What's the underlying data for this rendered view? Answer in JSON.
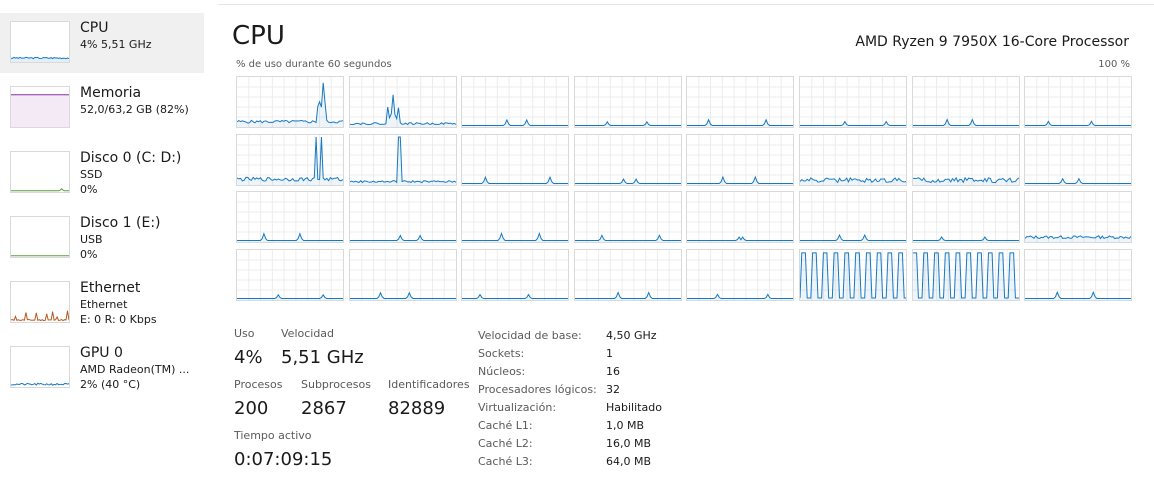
{
  "colors": {
    "cpu_line": "#1879c3",
    "memory_line": "#8b2fa8",
    "disk_line": "#5d9e3a",
    "ethernet_line": "#b8581e",
    "grid": "#ececec",
    "border": "#d9d9d9",
    "selected_bg": "#f0f0f0"
  },
  "sidebar": {
    "items": [
      {
        "title": "CPU",
        "lines": [
          "4% 5,51 GHz"
        ],
        "icon": "cpu-mini-graph"
      },
      {
        "title": "Memoria",
        "lines": [
          "52,0/63,2 GB (82%)"
        ],
        "icon": "memory-mini-graph"
      },
      {
        "title": "Disco 0 (C: D:)",
        "lines": [
          "SSD",
          "0%"
        ],
        "icon": "disk-mini-graph"
      },
      {
        "title": "Disco 1 (E:)",
        "lines": [
          "USB",
          "0%"
        ],
        "icon": "disk-mini-graph"
      },
      {
        "title": "Ethernet",
        "lines": [
          "Ethernet",
          "E: 0 R: 0 Kbps"
        ],
        "icon": "network-mini-graph"
      },
      {
        "title": "GPU 0",
        "lines": [
          "AMD Radeon(TM) ...",
          "2% (40 °C)"
        ],
        "icon": "gpu-mini-graph"
      }
    ]
  },
  "main": {
    "title": "CPU",
    "processor": "AMD Ryzen 9 7950X 16-Core Processor",
    "graph_caption": "% de uso durante 60 segundos",
    "graph_max": "100 %",
    "stats": {
      "uso_label": "Uso",
      "uso_value": "4%",
      "velocidad_label": "Velocidad",
      "velocidad_value": "5,51 GHz",
      "procesos_label": "Procesos",
      "procesos_value": "200",
      "subprocesos_label": "Subprocesos",
      "subprocesos_value": "2867",
      "identificadores_label": "Identificadores",
      "identificadores_value": "82889",
      "tiempo_label": "Tiempo activo",
      "tiempo_value": "0:07:09:15"
    },
    "details": [
      {
        "key": "Velocidad de base:",
        "value": "4,50 GHz"
      },
      {
        "key": "Sockets:",
        "value": "1"
      },
      {
        "key": "Núcleos:",
        "value": "16"
      },
      {
        "key": "Procesadores lógicos:",
        "value": "32"
      },
      {
        "key": "Virtualización:",
        "value": "Habilitado"
      },
      {
        "key": "Caché L1:",
        "value": "1,0 MB"
      },
      {
        "key": "Caché L2:",
        "value": "16,0 MB"
      },
      {
        "key": "Caché L3:",
        "value": "64,0 MB"
      }
    ]
  },
  "core_graphs": {
    "count": 32,
    "columns": 8,
    "y_max_percent": 100
  }
}
